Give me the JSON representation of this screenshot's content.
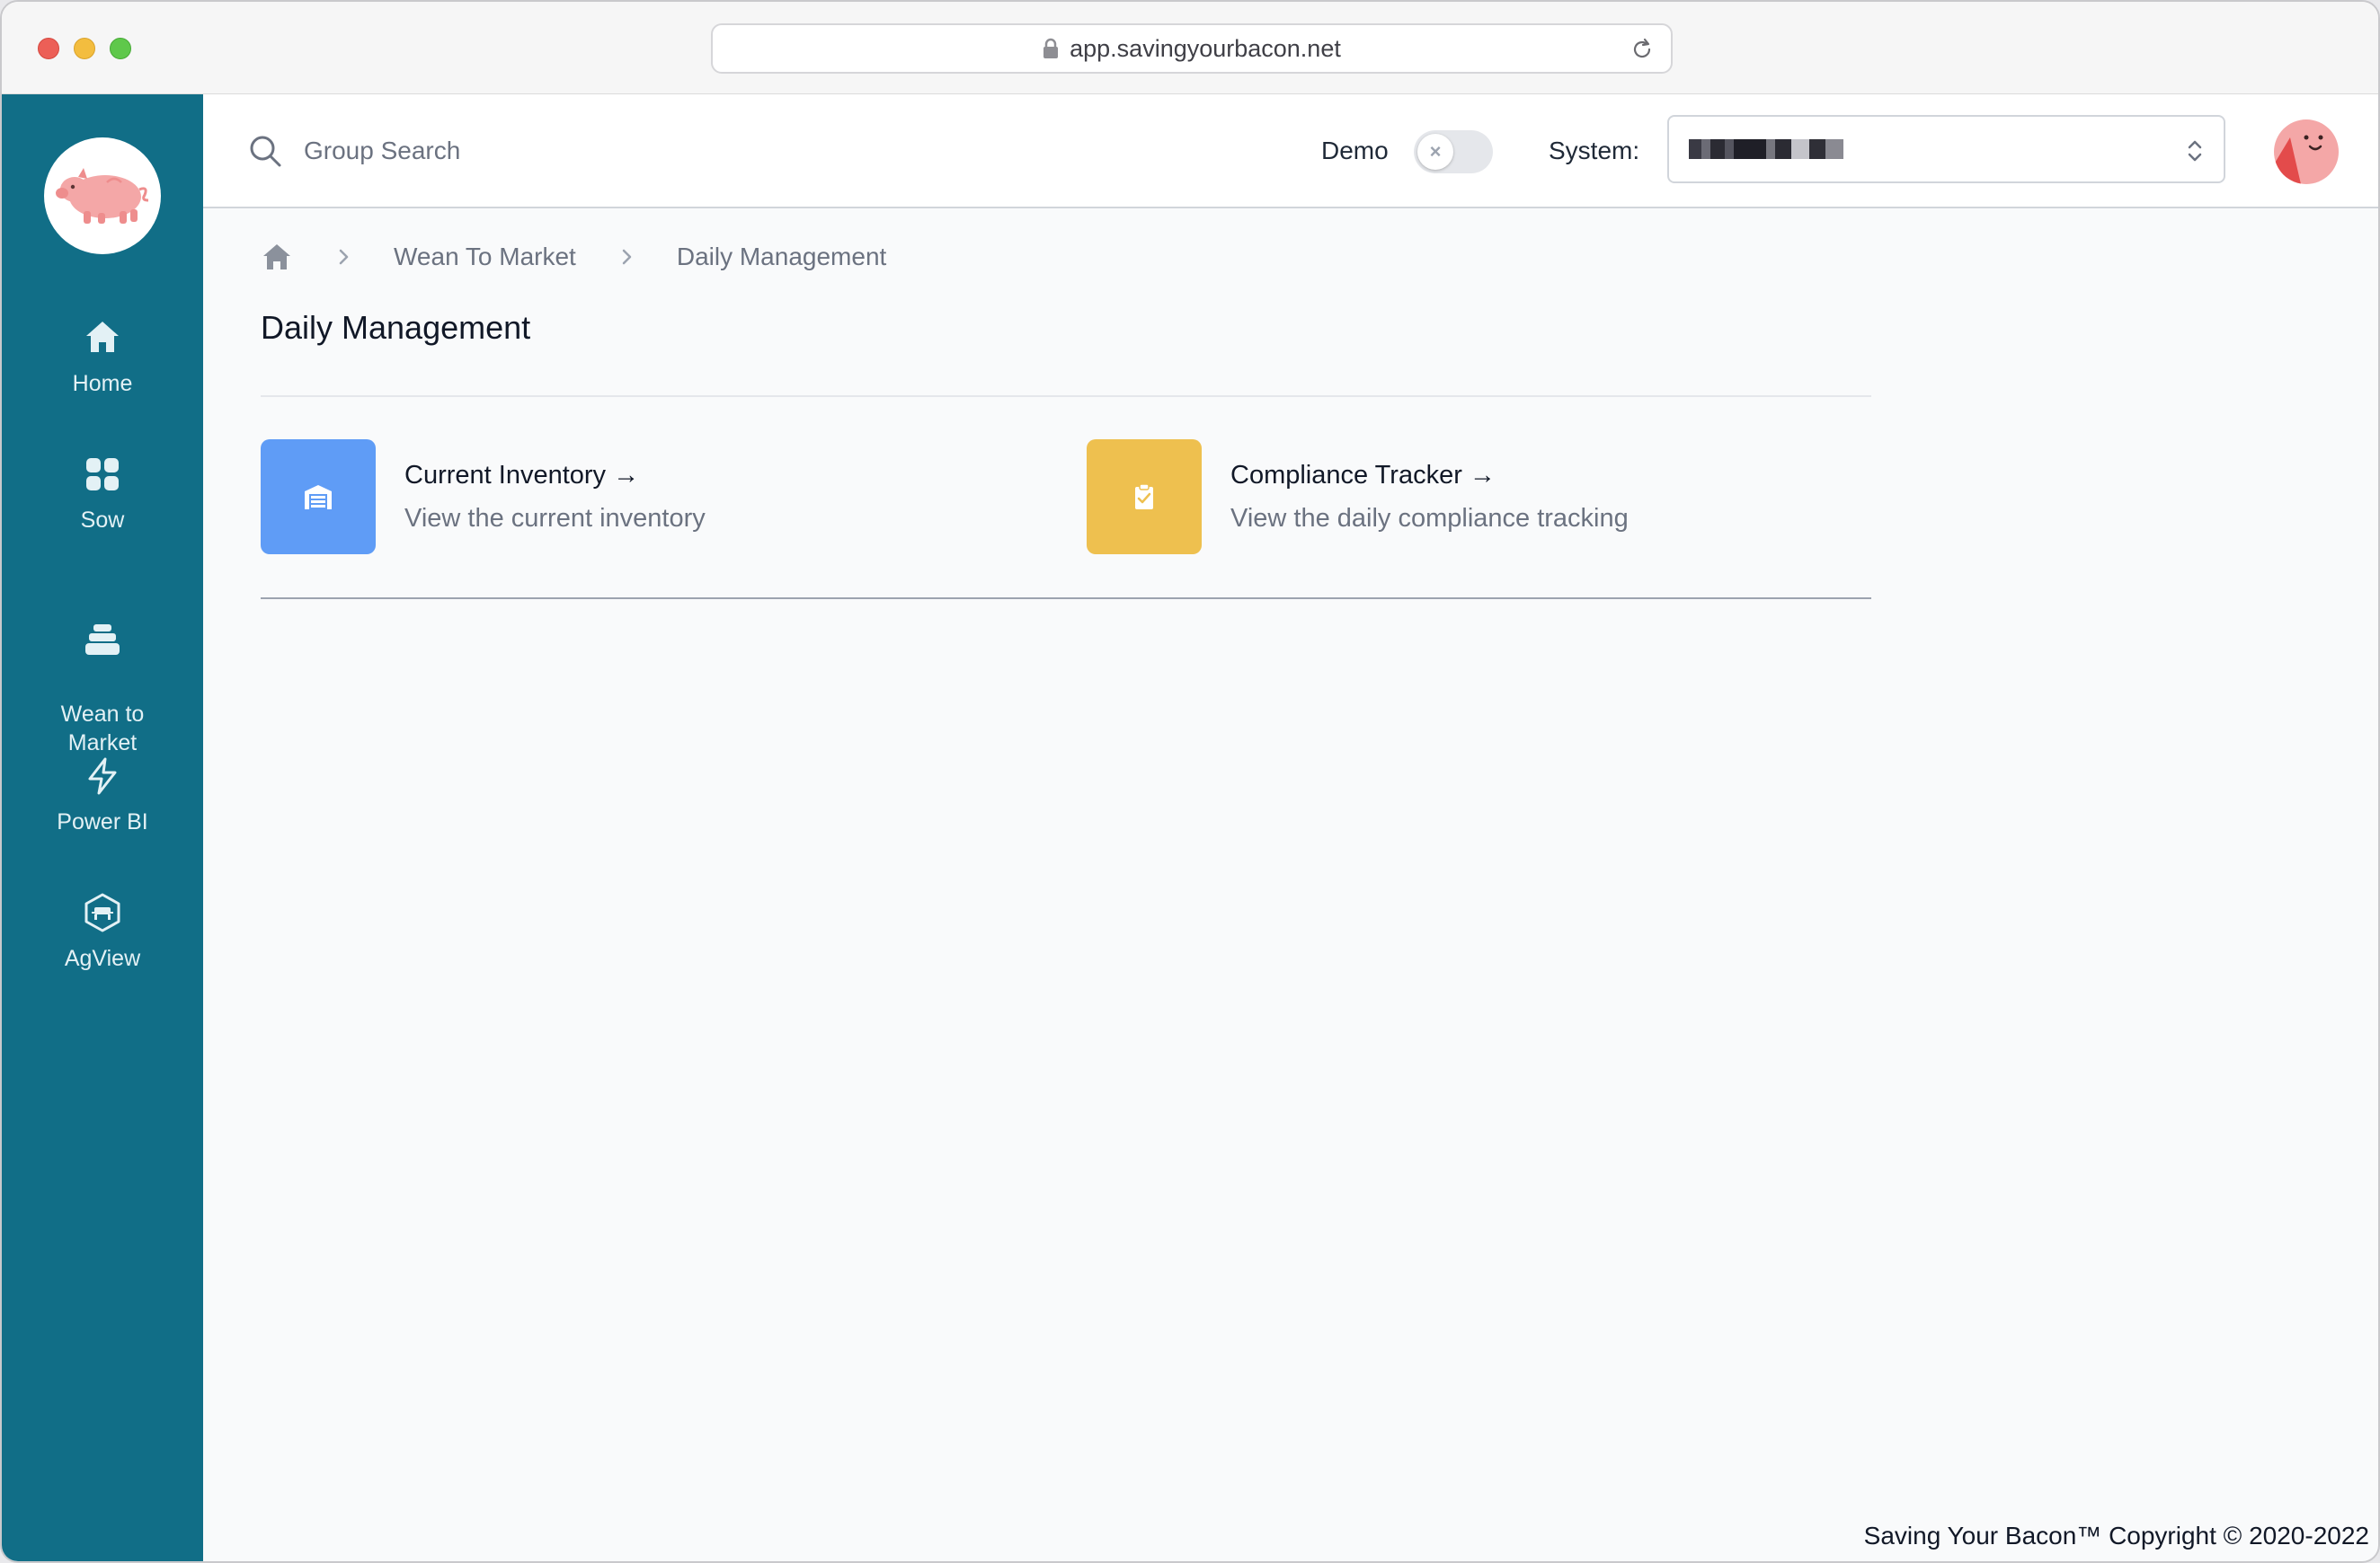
{
  "browser": {
    "url": "app.savingyourbacon.net"
  },
  "sidebar": {
    "items": [
      {
        "label": "Home",
        "icon": "home-icon"
      },
      {
        "label": "Sow",
        "icon": "grid-icon"
      },
      {
        "label": "Wean to\nMarket",
        "icon": "stack-icon"
      },
      {
        "label": "Power BI",
        "icon": "lightning-icon"
      },
      {
        "label": "AgView",
        "icon": "agview-icon"
      }
    ]
  },
  "header": {
    "search_placeholder": "Group Search",
    "demo_label": "Demo",
    "demo_enabled": false,
    "system_label": "System:"
  },
  "breadcrumb": {
    "items": [
      "Wean To Market",
      "Daily Management"
    ]
  },
  "page": {
    "title": "Daily Management",
    "cards": [
      {
        "title": "Current Inventory →",
        "description": "View the current inventory",
        "color": "#5f9cf6",
        "icon": "warehouse-icon"
      },
      {
        "title": "Compliance Tracker →",
        "description": "View the daily compliance tracking",
        "color": "#eec04f",
        "icon": "clipboard-check-icon"
      }
    ]
  },
  "footer": {
    "copyright": "Saving Your Bacon™ Copyright © 2020-2022"
  },
  "colors": {
    "sidebar": "#116e87",
    "accent_blue": "#5f9cf6",
    "accent_yellow": "#eec04f"
  }
}
